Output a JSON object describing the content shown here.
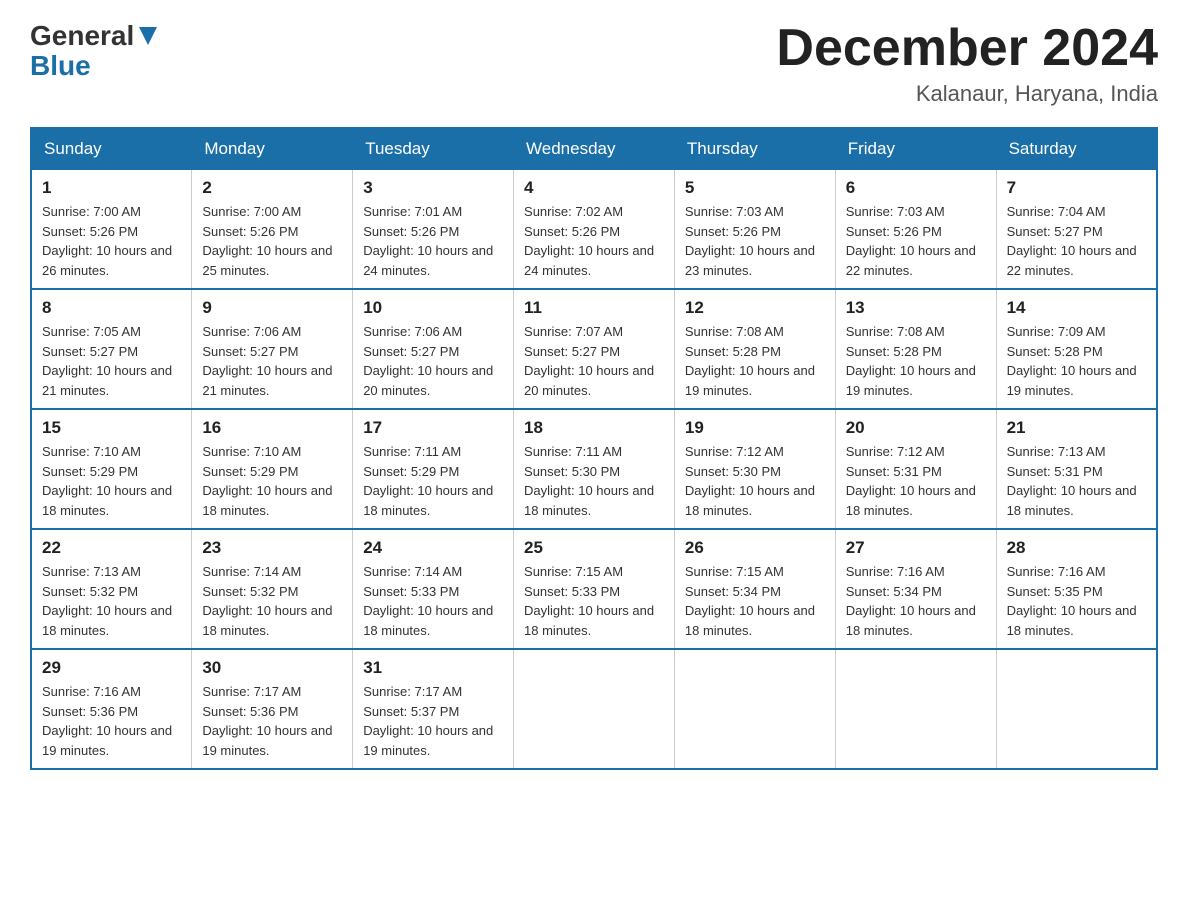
{
  "header": {
    "logo": {
      "general": "General",
      "arrow": "▲",
      "blue": "Blue"
    },
    "title": "December 2024",
    "location": "Kalanaur, Haryana, India"
  },
  "calendar": {
    "days_of_week": [
      "Sunday",
      "Monday",
      "Tuesday",
      "Wednesday",
      "Thursday",
      "Friday",
      "Saturday"
    ],
    "weeks": [
      [
        {
          "day": "1",
          "sunrise": "7:00 AM",
          "sunset": "5:26 PM",
          "daylight": "10 hours and 26 minutes."
        },
        {
          "day": "2",
          "sunrise": "7:00 AM",
          "sunset": "5:26 PM",
          "daylight": "10 hours and 25 minutes."
        },
        {
          "day": "3",
          "sunrise": "7:01 AM",
          "sunset": "5:26 PM",
          "daylight": "10 hours and 24 minutes."
        },
        {
          "day": "4",
          "sunrise": "7:02 AM",
          "sunset": "5:26 PM",
          "daylight": "10 hours and 24 minutes."
        },
        {
          "day": "5",
          "sunrise": "7:03 AM",
          "sunset": "5:26 PM",
          "daylight": "10 hours and 23 minutes."
        },
        {
          "day": "6",
          "sunrise": "7:03 AM",
          "sunset": "5:26 PM",
          "daylight": "10 hours and 22 minutes."
        },
        {
          "day": "7",
          "sunrise": "7:04 AM",
          "sunset": "5:27 PM",
          "daylight": "10 hours and 22 minutes."
        }
      ],
      [
        {
          "day": "8",
          "sunrise": "7:05 AM",
          "sunset": "5:27 PM",
          "daylight": "10 hours and 21 minutes."
        },
        {
          "day": "9",
          "sunrise": "7:06 AM",
          "sunset": "5:27 PM",
          "daylight": "10 hours and 21 minutes."
        },
        {
          "day": "10",
          "sunrise": "7:06 AM",
          "sunset": "5:27 PM",
          "daylight": "10 hours and 20 minutes."
        },
        {
          "day": "11",
          "sunrise": "7:07 AM",
          "sunset": "5:27 PM",
          "daylight": "10 hours and 20 minutes."
        },
        {
          "day": "12",
          "sunrise": "7:08 AM",
          "sunset": "5:28 PM",
          "daylight": "10 hours and 19 minutes."
        },
        {
          "day": "13",
          "sunrise": "7:08 AM",
          "sunset": "5:28 PM",
          "daylight": "10 hours and 19 minutes."
        },
        {
          "day": "14",
          "sunrise": "7:09 AM",
          "sunset": "5:28 PM",
          "daylight": "10 hours and 19 minutes."
        }
      ],
      [
        {
          "day": "15",
          "sunrise": "7:10 AM",
          "sunset": "5:29 PM",
          "daylight": "10 hours and 18 minutes."
        },
        {
          "day": "16",
          "sunrise": "7:10 AM",
          "sunset": "5:29 PM",
          "daylight": "10 hours and 18 minutes."
        },
        {
          "day": "17",
          "sunrise": "7:11 AM",
          "sunset": "5:29 PM",
          "daylight": "10 hours and 18 minutes."
        },
        {
          "day": "18",
          "sunrise": "7:11 AM",
          "sunset": "5:30 PM",
          "daylight": "10 hours and 18 minutes."
        },
        {
          "day": "19",
          "sunrise": "7:12 AM",
          "sunset": "5:30 PM",
          "daylight": "10 hours and 18 minutes."
        },
        {
          "day": "20",
          "sunrise": "7:12 AM",
          "sunset": "5:31 PM",
          "daylight": "10 hours and 18 minutes."
        },
        {
          "day": "21",
          "sunrise": "7:13 AM",
          "sunset": "5:31 PM",
          "daylight": "10 hours and 18 minutes."
        }
      ],
      [
        {
          "day": "22",
          "sunrise": "7:13 AM",
          "sunset": "5:32 PM",
          "daylight": "10 hours and 18 minutes."
        },
        {
          "day": "23",
          "sunrise": "7:14 AM",
          "sunset": "5:32 PM",
          "daylight": "10 hours and 18 minutes."
        },
        {
          "day": "24",
          "sunrise": "7:14 AM",
          "sunset": "5:33 PM",
          "daylight": "10 hours and 18 minutes."
        },
        {
          "day": "25",
          "sunrise": "7:15 AM",
          "sunset": "5:33 PM",
          "daylight": "10 hours and 18 minutes."
        },
        {
          "day": "26",
          "sunrise": "7:15 AM",
          "sunset": "5:34 PM",
          "daylight": "10 hours and 18 minutes."
        },
        {
          "day": "27",
          "sunrise": "7:16 AM",
          "sunset": "5:34 PM",
          "daylight": "10 hours and 18 minutes."
        },
        {
          "day": "28",
          "sunrise": "7:16 AM",
          "sunset": "5:35 PM",
          "daylight": "10 hours and 18 minutes."
        }
      ],
      [
        {
          "day": "29",
          "sunrise": "7:16 AM",
          "sunset": "5:36 PM",
          "daylight": "10 hours and 19 minutes."
        },
        {
          "day": "30",
          "sunrise": "7:17 AM",
          "sunset": "5:36 PM",
          "daylight": "10 hours and 19 minutes."
        },
        {
          "day": "31",
          "sunrise": "7:17 AM",
          "sunset": "5:37 PM",
          "daylight": "10 hours and 19 minutes."
        },
        null,
        null,
        null,
        null
      ]
    ],
    "labels": {
      "sunrise": "Sunrise:",
      "sunset": "Sunset:",
      "daylight": "Daylight:"
    }
  }
}
